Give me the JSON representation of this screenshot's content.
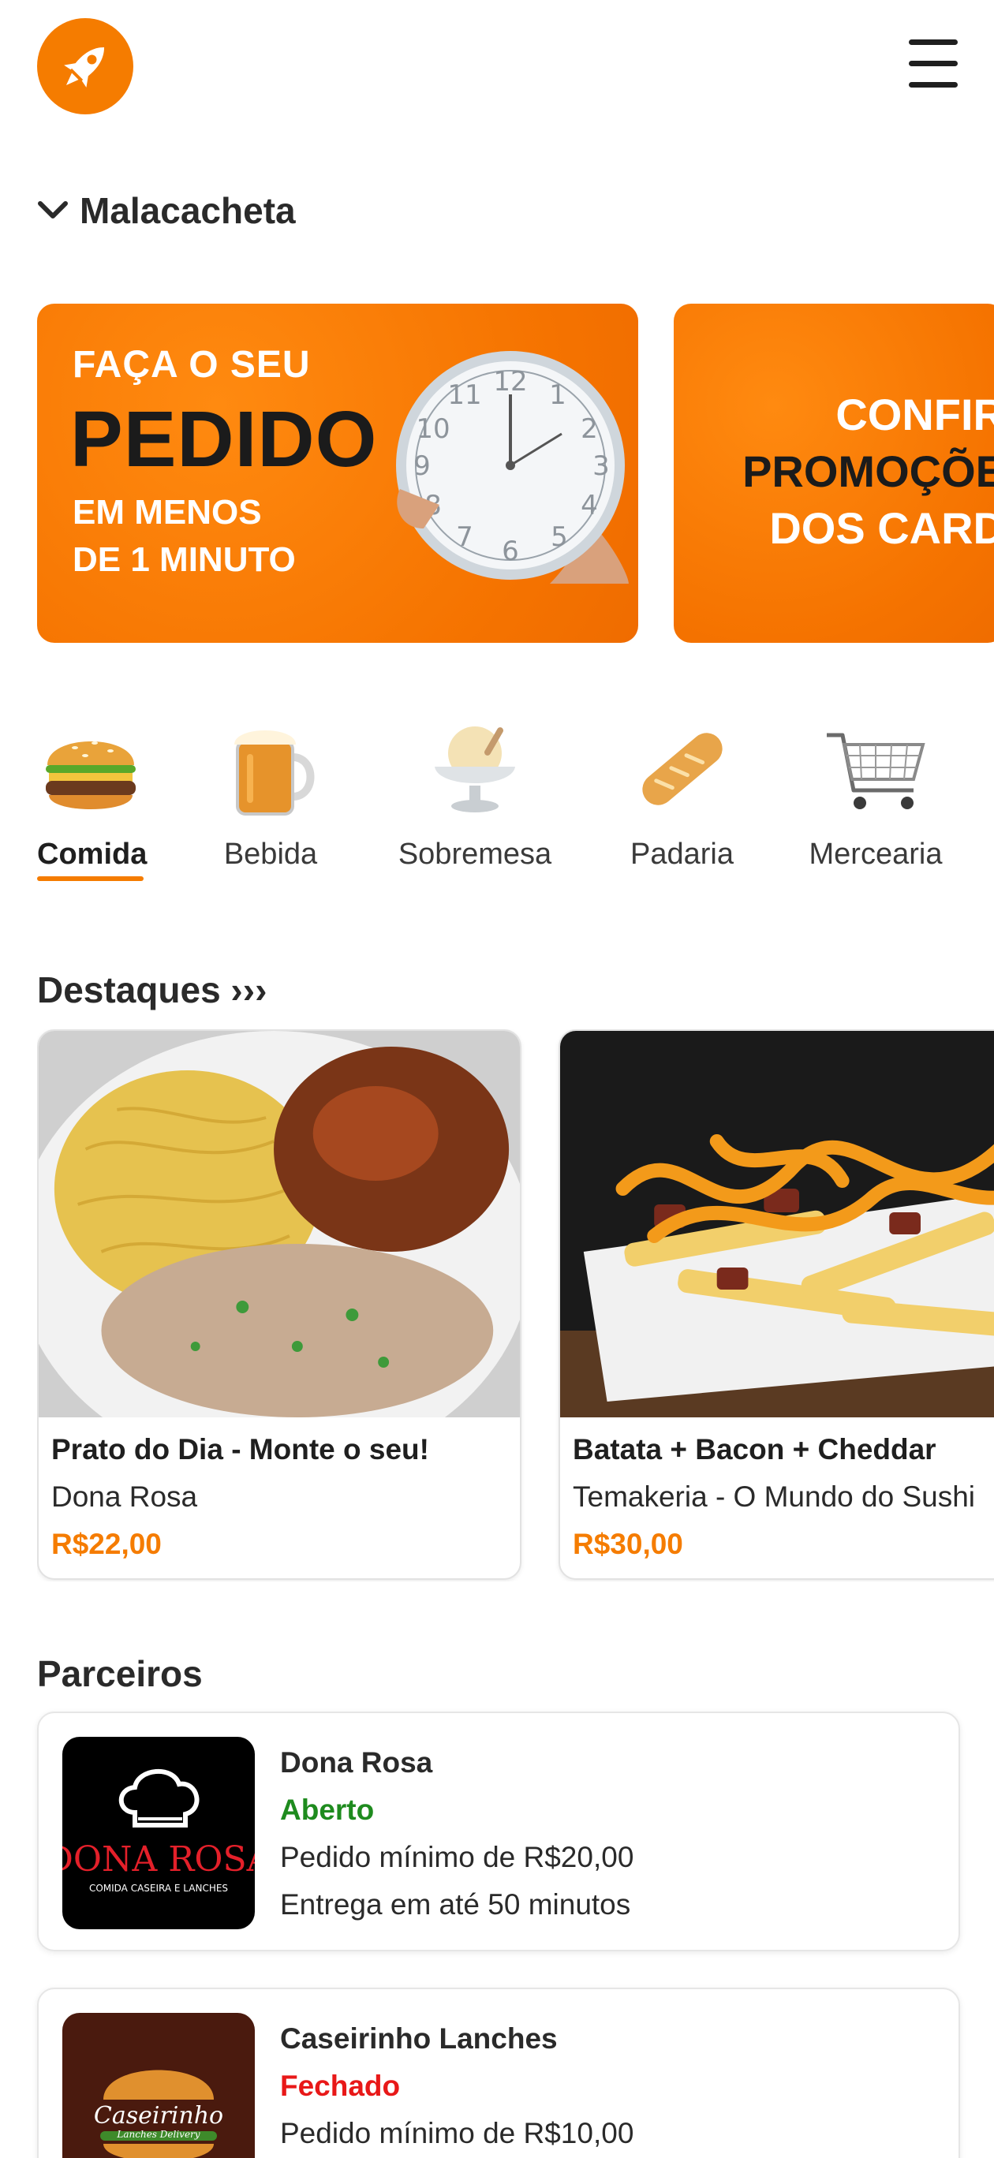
{
  "header": {
    "logo_icon": "rocket-icon",
    "menu_icon": "hamburger-menu-icon",
    "accent_color": "#f57c00"
  },
  "location": {
    "city": "Malacacheta"
  },
  "banners": [
    {
      "line1": "FAÇA O SEU",
      "line2": "PEDIDO",
      "line3": "EM MENOS",
      "line4": "DE 1 MINUTO"
    },
    {
      "line1": "CONFIR",
      "line2": "PROMOÇÕE",
      "line3": "DOS CARD"
    }
  ],
  "categories": [
    {
      "label": "Comida",
      "icon": "burger-icon",
      "active": true
    },
    {
      "label": "Bebida",
      "icon": "beer-mug-icon",
      "active": false
    },
    {
      "label": "Sobremesa",
      "icon": "ice-cream-icon",
      "active": false
    },
    {
      "label": "Padaria",
      "icon": "bread-icon",
      "active": false
    },
    {
      "label": "Mercearia",
      "icon": "shopping-cart-icon",
      "active": false
    }
  ],
  "highlights": {
    "title": "Destaques ›››",
    "items": [
      {
        "name": "Prato do Dia - Monte o seu!",
        "store": "Dona Rosa",
        "price": "R$22,00"
      },
      {
        "name": "Batata + Bacon + Cheddar",
        "store": "Temakeria - O Mundo do Sushi",
        "price": "R$30,00"
      }
    ]
  },
  "partners": {
    "title": "Parceiros",
    "items": [
      {
        "name": "Dona Rosa",
        "status": "Aberto",
        "min_order": "Pedido mínimo de R$20,00",
        "eta": "Entrega em até 50 minutos",
        "logo_text": "DONA ROSA",
        "logo_subtext": "COMIDA CASEIRA E LANCHES"
      },
      {
        "name": "Caseirinho Lanches",
        "status": "Fechado",
        "min_order": "Pedido mínimo de R$10,00",
        "logo_text": "Caseirinho",
        "logo_subtext": "Lanches Delivery"
      }
    ]
  }
}
